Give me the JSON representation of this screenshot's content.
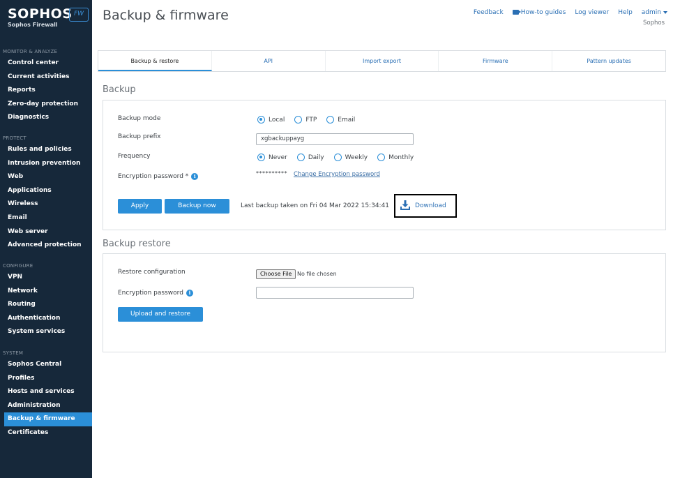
{
  "brand": {
    "name": "SOPHOS",
    "badge": "FW",
    "product": "Sophos Firewall"
  },
  "sidebar": {
    "groups": [
      {
        "heading": "MONITOR & ANALYZE",
        "items": [
          "Control center",
          "Current activities",
          "Reports",
          "Zero-day protection",
          "Diagnostics"
        ]
      },
      {
        "heading": "PROTECT",
        "items": [
          "Rules and policies",
          "Intrusion prevention",
          "Web",
          "Applications",
          "Wireless",
          "Email",
          "Web server",
          "Advanced protection"
        ]
      },
      {
        "heading": "CONFIGURE",
        "items": [
          "VPN",
          "Network",
          "Routing",
          "Authentication",
          "System services"
        ]
      },
      {
        "heading": "SYSTEM",
        "items": [
          "Sophos Central",
          "Profiles",
          "Hosts and services",
          "Administration",
          "Backup & firmware",
          "Certificates"
        ]
      }
    ],
    "active": "Backup & firmware"
  },
  "header": {
    "title": "Backup & firmware",
    "links": {
      "feedback": "Feedback",
      "howto": "How-to guides",
      "log_viewer": "Log viewer",
      "help": "Help",
      "admin": "admin"
    },
    "org": "Sophos"
  },
  "tabs": [
    "Backup & restore",
    "API",
    "Import export",
    "Firmware",
    "Pattern updates"
  ],
  "active_tab": "Backup & restore",
  "backup": {
    "section_title": "Backup",
    "mode_label": "Backup mode",
    "modes": [
      "Local",
      "FTP",
      "Email"
    ],
    "mode_selected": "Local",
    "prefix_label": "Backup prefix",
    "prefix_value": "xgbackuppayg",
    "frequency_label": "Frequency",
    "frequencies": [
      "Never",
      "Daily",
      "Weekly",
      "Monthly"
    ],
    "frequency_selected": "Never",
    "encryption_label": "Encryption password *",
    "password_mask": "**********",
    "change_password_link": "Change Encryption password",
    "apply_label": "Apply",
    "backup_now_label": "Backup now",
    "last_backup": "Last backup taken on Fri 04 Mar 2022 15:34:41",
    "download_label": "Download"
  },
  "restore": {
    "section_title": "Backup restore",
    "config_label": "Restore configuration",
    "choose_file_label": "Choose File",
    "no_file_text": "No file chosen",
    "encryption_label": "Encryption password",
    "encryption_value": "",
    "upload_label": "Upload and restore"
  },
  "colors": {
    "sidebar_bg": "#16283a",
    "accent": "#2b8fd8",
    "link": "#2a6fb4"
  }
}
